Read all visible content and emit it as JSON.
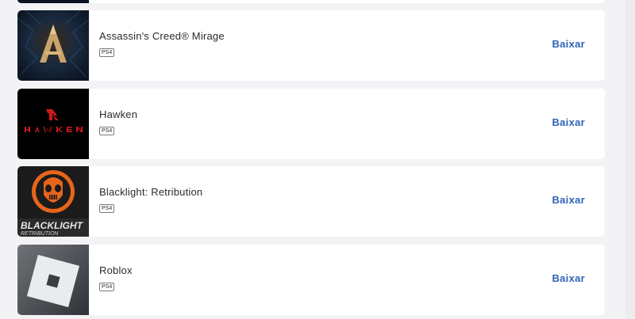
{
  "games": [
    {
      "title": "Assassin's Creed® Mirage",
      "platform": "PS4",
      "action": "Baixar",
      "thumb_icon": "assassins-creed-mirage-cover"
    },
    {
      "title": "Hawken",
      "platform": "PS4",
      "action": "Baixar",
      "thumb_icon": "hawken-cover"
    },
    {
      "title": "Blacklight: Retribution",
      "platform": "PS4",
      "action": "Baixar",
      "thumb_icon": "blacklight-retribution-cover"
    },
    {
      "title": "Roblox",
      "platform": "PS4",
      "action": "Baixar",
      "thumb_icon": "roblox-cover"
    }
  ],
  "colors": {
    "page_bg": "#f3f3f6",
    "card_bg": "#ffffff",
    "action_text": "#2f63b7",
    "title_text": "#2b2b2b"
  }
}
